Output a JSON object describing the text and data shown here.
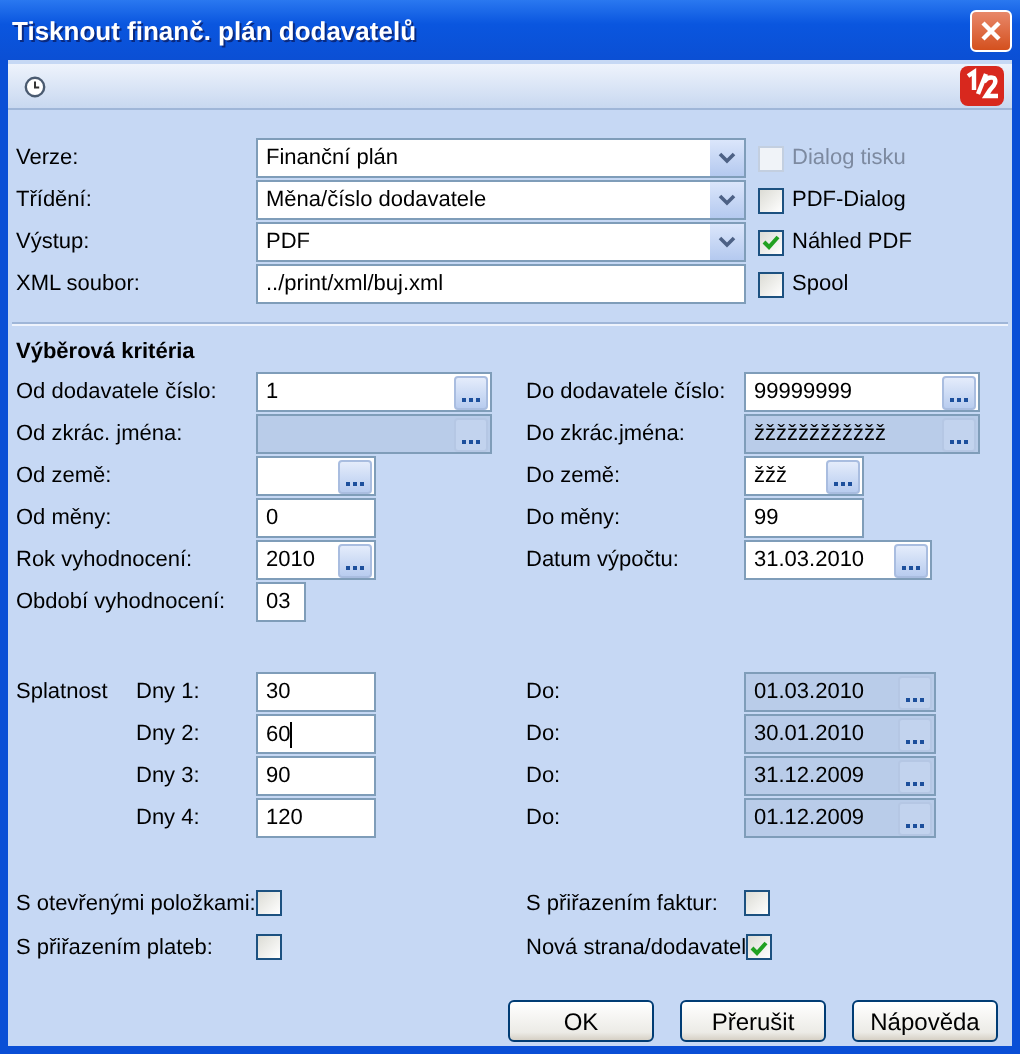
{
  "window": {
    "title": "Tisknout finanč. plán dodavatelů"
  },
  "top_rows": [
    {
      "label": "Verze:",
      "kind": "combo",
      "value": "Finanční plán",
      "option": {
        "label": "Dialog tisku",
        "checked": false,
        "disabled": true
      }
    },
    {
      "label": "Třídění:",
      "kind": "combo",
      "value": "Měna/číslo dodavatele",
      "option": {
        "label": "PDF-Dialog",
        "checked": false,
        "disabled": false
      }
    },
    {
      "label": "Výstup:",
      "kind": "combo",
      "value": "PDF",
      "option": {
        "label": "Náhled PDF",
        "checked": true,
        "disabled": false
      }
    },
    {
      "label": "XML soubor:",
      "kind": "text",
      "value": "../print/xml/buj.xml",
      "option": {
        "label": "Spool",
        "checked": false,
        "disabled": false
      }
    }
  ],
  "criteria": {
    "title": "Výběrová kritéria",
    "rows": [
      {
        "left": {
          "label": "Od dodavatele číslo:",
          "value": "1",
          "browse": true,
          "disabled": false
        },
        "right": {
          "label": "Do dodavatele číslo:",
          "value": "99999999",
          "browse": true,
          "disabled": false
        }
      },
      {
        "left": {
          "label": "Od zkrác. jména:",
          "browse": true,
          "disabled": true
        },
        "right": {
          "label": "Do zkrác.jména:",
          "value": "žžžžžžžžžžžž",
          "browse": true,
          "disabled": true
        }
      },
      {
        "left": {
          "label": "Od země:",
          "browse": true,
          "disabled": false
        },
        "right": {
          "label": "Do země:",
          "value": "žžž",
          "browse": true,
          "disabled": false
        }
      },
      {
        "left": {
          "label": "Od měny:",
          "value": "0",
          "browse": false,
          "disabled": false
        },
        "right": {
          "label": "Do měny:",
          "value": "99",
          "browse": false,
          "disabled": false
        }
      },
      {
        "left": {
          "label": "Rok vyhodnocení:",
          "value": "2010",
          "browse": true,
          "disabled": false
        },
        "right": {
          "label": "Datum výpočtu:",
          "value": "31.03.2010",
          "browse": true,
          "disabled": false
        }
      },
      {
        "left": {
          "label": "Období vyhodnocení:",
          "value": "03",
          "browse": false,
          "disabled": false
        }
      }
    ]
  },
  "due": {
    "label": "Splatnost",
    "rows": [
      {
        "label": "Dny 1:",
        "value": "30",
        "focused": false,
        "to_label": "Do:",
        "to_value": "01.03.2010"
      },
      {
        "label": "Dny 2:",
        "value": "60",
        "focused": true,
        "to_label": "Do:",
        "to_value": "30.01.2010"
      },
      {
        "label": "Dny 3:",
        "value": "90",
        "focused": false,
        "to_label": "Do:",
        "to_value": "31.12.2009"
      },
      {
        "label": "Dny 4:",
        "value": "120",
        "focused": false,
        "to_label": "Do:",
        "to_value": "01.12.2009"
      }
    ]
  },
  "options": [
    {
      "left": {
        "label": "S otevřenými položkami:",
        "checked": false
      },
      "right": {
        "label": "S přiřazením faktur:",
        "checked": false
      }
    },
    {
      "left": {
        "label": "S přiřazením plateb:",
        "checked": false
      },
      "right": {
        "label": "Nová strana/dodavatel",
        "checked": true
      }
    }
  ],
  "buttons": [
    {
      "label": "OK"
    },
    {
      "label": "Přerušit"
    },
    {
      "label": "Nápověda"
    }
  ]
}
